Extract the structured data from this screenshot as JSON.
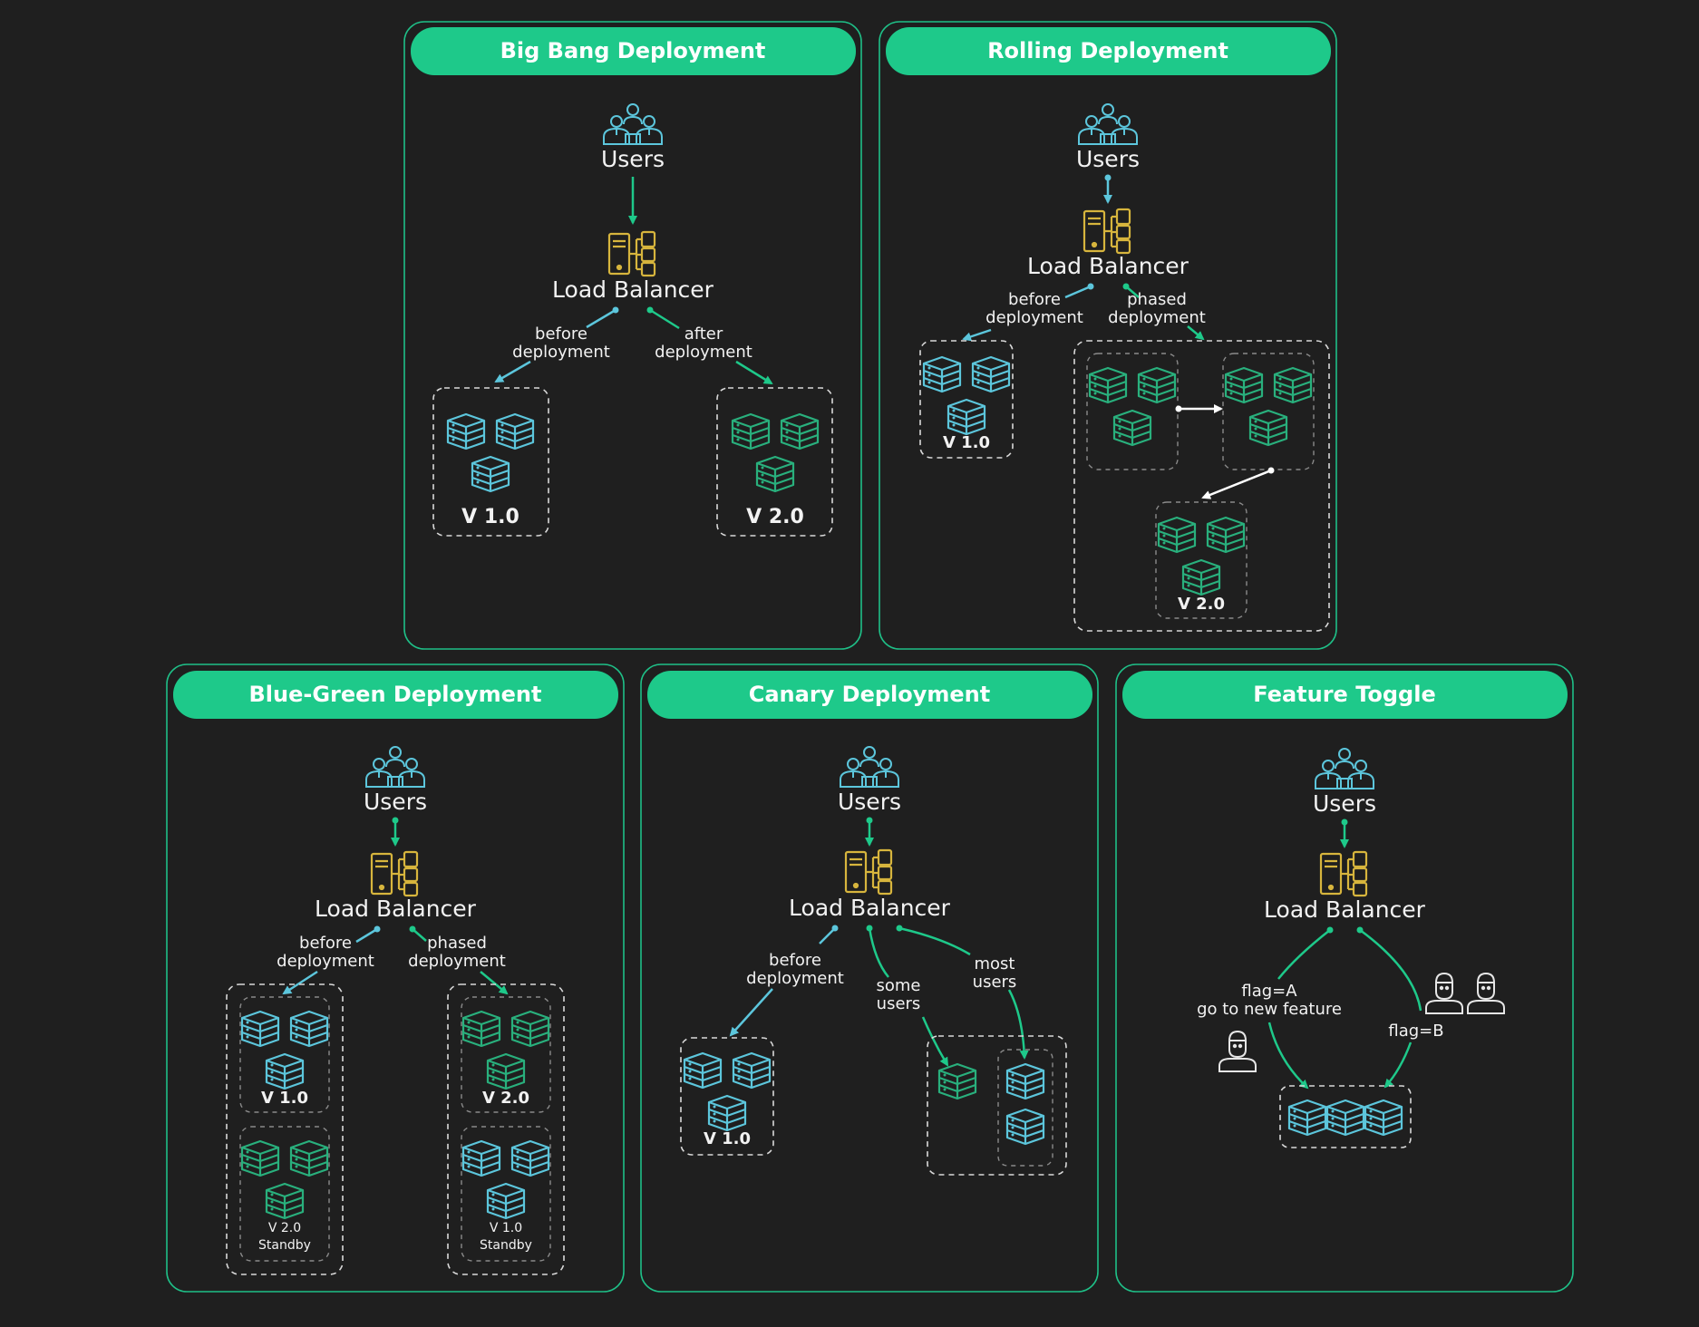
{
  "colors": {
    "background": "#1f1f1f",
    "accent": "#1ec98a",
    "old_version": "#5cc6dc",
    "new_version": "#29b07d",
    "load_balancer": "#d7b53d",
    "text": "#f2f2f2"
  },
  "icons": {
    "users": "users-group-icon",
    "load_balancer": "load-balancer-icon",
    "server": "server-stack-icon",
    "single_user": "user-icon"
  },
  "panels": {
    "bigbang": {
      "title": "Big Bang Deployment",
      "users": "Users",
      "lb": "Load Balancer",
      "left_l1": "before",
      "left_l2": "deployment",
      "right_l1": "after",
      "right_l2": "deployment",
      "v1": "V 1.0",
      "v2": "V 2.0"
    },
    "rolling": {
      "title": "Rolling Deployment",
      "users": "Users",
      "lb": "Load Balancer",
      "left_l1": "before",
      "left_l2": "deployment",
      "right_l1": "phased",
      "right_l2": "deployment",
      "v1": "V 1.0",
      "v2": "V 2.0"
    },
    "bluegreen": {
      "title": "Blue-Green Deployment",
      "users": "Users",
      "lb": "Load Balancer",
      "left_l1": "before",
      "left_l2": "deployment",
      "right_l1": "phased",
      "right_l2": "deployment",
      "left_top": "V 1.0",
      "left_bottom_l1": "V 2.0",
      "left_bottom_l2": "Standby",
      "right_top": "V 2.0",
      "right_bottom_l1": "V 1.0",
      "right_bottom_l2": "Standby"
    },
    "canary": {
      "title": "Canary Deployment",
      "users": "Users",
      "lb": "Load Balancer",
      "left_l1": "before",
      "left_l2": "deployment",
      "mid_l1": "some",
      "mid_l2": "users",
      "right_l1": "most",
      "right_l2": "users",
      "v1": "V 1.0"
    },
    "feature": {
      "title": "Feature Toggle",
      "users": "Users",
      "lb": "Load Balancer",
      "flag_a_l1": "flag=A",
      "flag_a_l2": "go to new feature",
      "flag_b": "flag=B"
    }
  }
}
